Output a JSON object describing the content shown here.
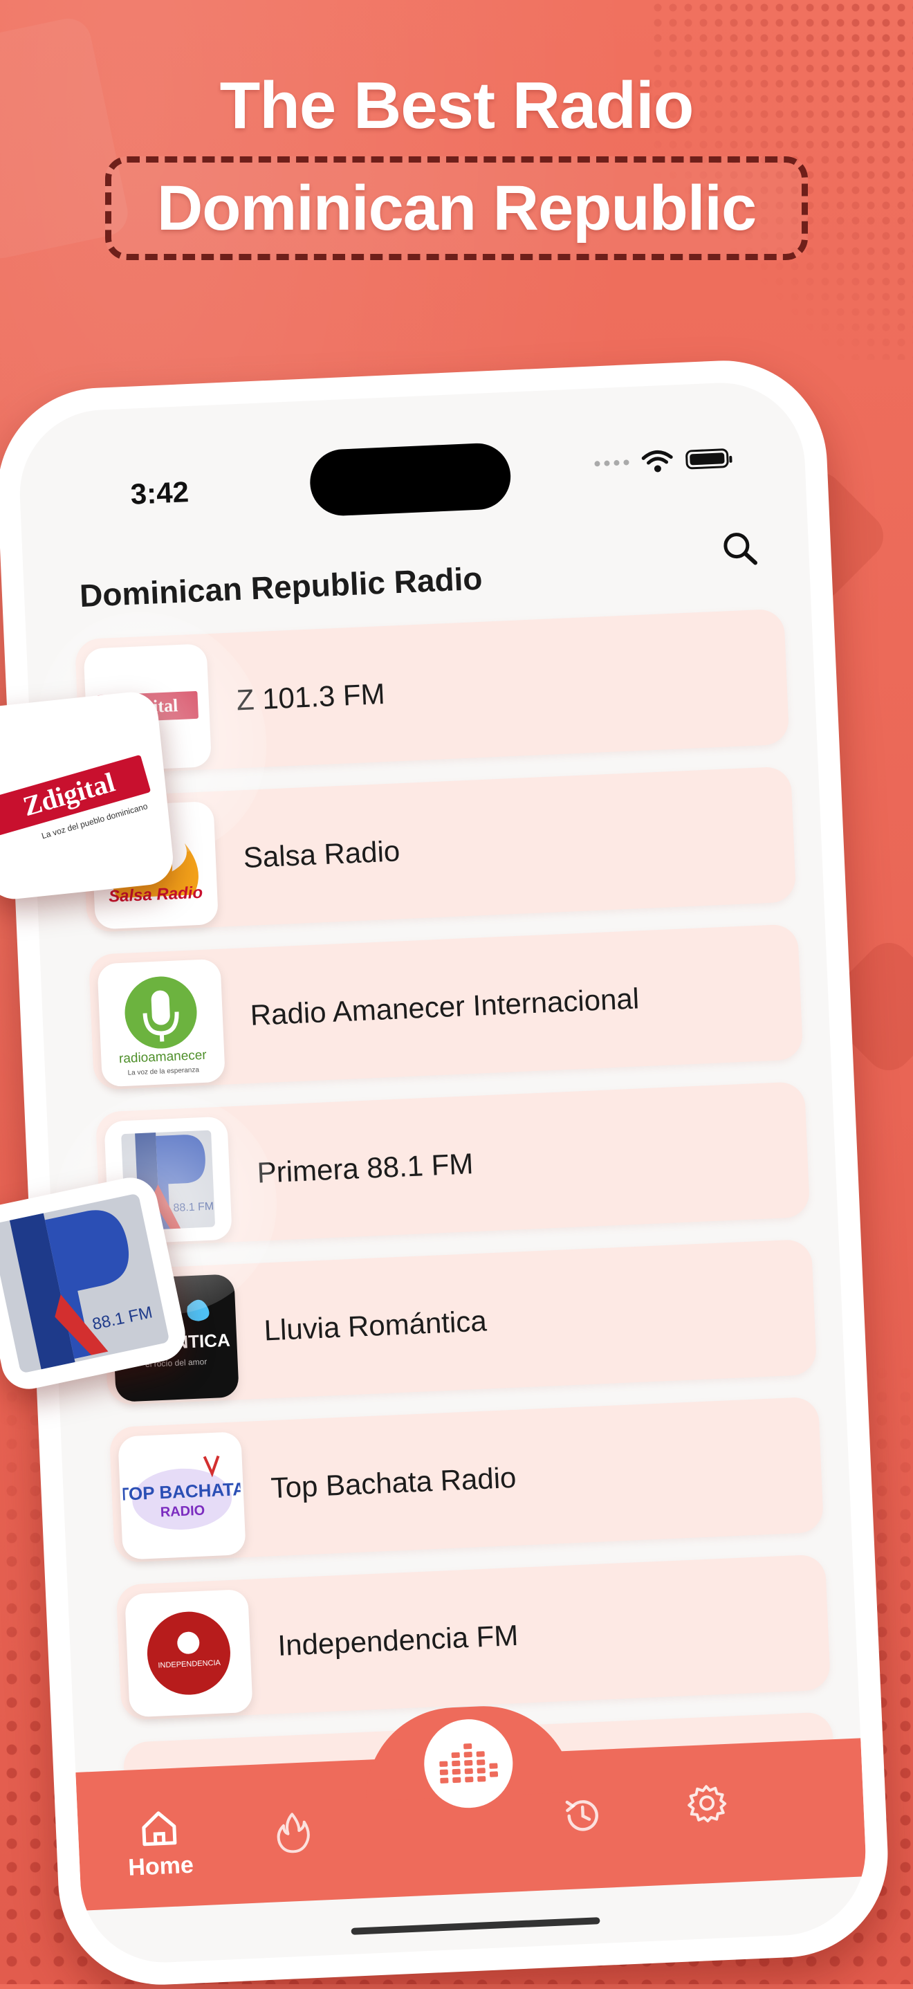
{
  "promo": {
    "headline": "The Best Radio",
    "subheadline": "Dominican Republic"
  },
  "status_bar": {
    "time": "3:42"
  },
  "app": {
    "title": "Dominican Republic Radio",
    "search_icon": "search-icon"
  },
  "stations": [
    {
      "name": "Z 101.3 FM",
      "logo_text": "Zdigital",
      "logo_sub": "La voz del pueblo dominicano"
    },
    {
      "name": "Salsa Radio",
      "logo_text": "Salsa Radio"
    },
    {
      "name": "Radio Amanecer Internacional",
      "logo_text": "radioamanecer",
      "logo_sub": "La voz de la esperanza"
    },
    {
      "name": "Primera 88.1 FM",
      "logo_text": "88.1 FM"
    },
    {
      "name": "Lluvia Romántica",
      "logo_text": "ROMÁNTICA",
      "logo_sub": "el rocío del amor"
    },
    {
      "name": "Top Bachata Radio",
      "logo_text": "TOP BACHATA",
      "logo_sub": "RADIO"
    },
    {
      "name": "Independencia FM",
      "logo_text": "INDEPENDENCIA"
    }
  ],
  "nav": {
    "items": [
      {
        "id": "home",
        "icon": "home-icon",
        "label": "Home",
        "active": true
      },
      {
        "id": "trending",
        "icon": "fire-icon",
        "label": ""
      },
      {
        "id": "player",
        "icon": "equalizer-icon",
        "label": ""
      },
      {
        "id": "history",
        "icon": "history-icon",
        "label": ""
      },
      {
        "id": "settings",
        "icon": "gear-icon",
        "label": ""
      }
    ]
  },
  "colors": {
    "background": "#EE6B5B",
    "accent": "#EE6B5B",
    "row_bg": "#FDE9E4",
    "dark_accent": "#6E1F1A"
  }
}
